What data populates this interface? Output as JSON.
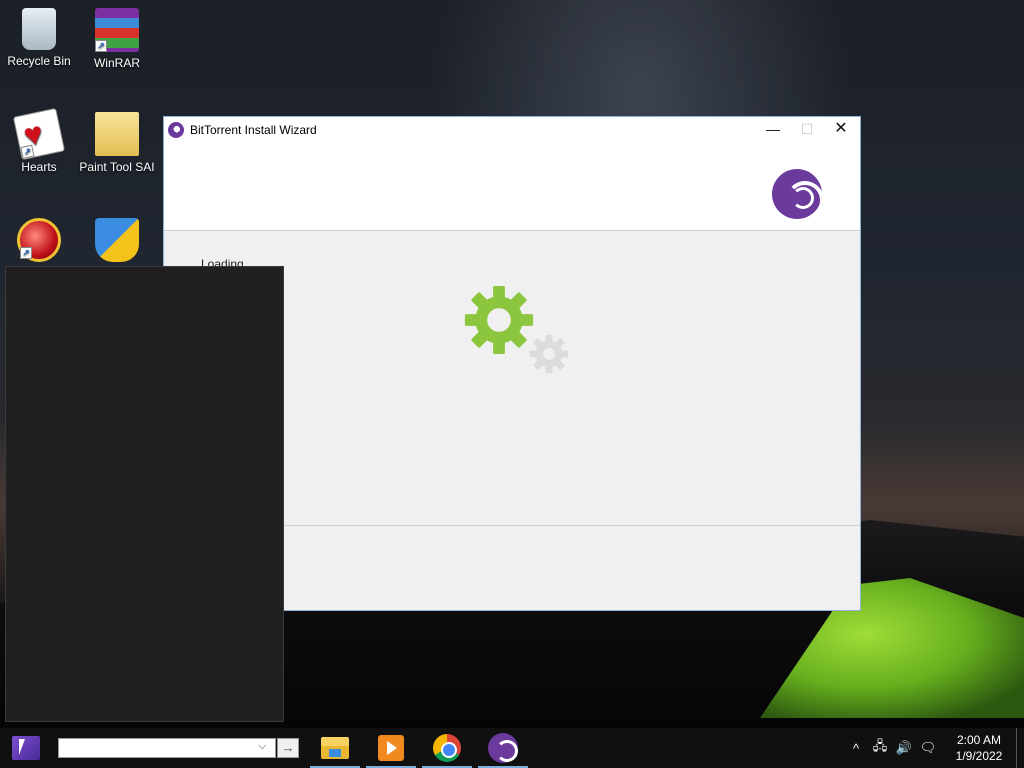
{
  "desktop": {
    "icons": [
      {
        "label": "Recycle Bin",
        "icon": "recycle-bin-icon"
      },
      {
        "label": "WinRAR",
        "icon": "winrar-icon"
      },
      {
        "label": "Hearts",
        "icon": "hearts-icon"
      },
      {
        "label": "Paint Tool SAI",
        "icon": "folder-icon"
      },
      {
        "label": "",
        "icon": "red-app-icon"
      },
      {
        "label": "",
        "icon": "shield-update-icon"
      }
    ]
  },
  "installer": {
    "title": "BitTorrent Install Wizard",
    "status_text": "Loading...",
    "window_controls": {
      "minimize": "—",
      "maximize": "☐",
      "close": "✕"
    },
    "colors": {
      "brand": "#6a3b9c",
      "gear_active": "#8cc63f",
      "gear_inactive": "#dcdcdc"
    }
  },
  "taskbar": {
    "search": {
      "value": "",
      "placeholder": ""
    },
    "search_go_glyph": "→",
    "apps": [
      {
        "name": "File Explorer",
        "icon": "file-explorer-icon",
        "active": true
      },
      {
        "name": "Media Player",
        "icon": "media-player-icon",
        "active": true
      },
      {
        "name": "Google Chrome",
        "icon": "chrome-icon",
        "active": true
      },
      {
        "name": "BitTorrent",
        "icon": "bittorrent-icon",
        "active": true
      }
    ],
    "tray": {
      "chevron": "^",
      "network": "🖧",
      "volume": "🔊",
      "notifications": "🗨",
      "time": "2:00 AM",
      "date": "1/9/2022"
    }
  }
}
